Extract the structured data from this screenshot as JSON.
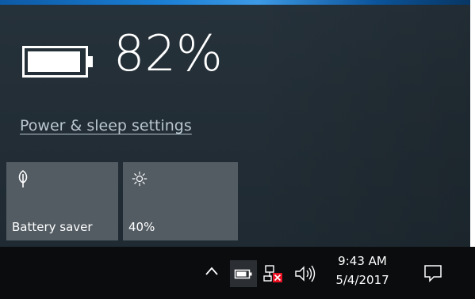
{
  "battery_flyout": {
    "percent": "82%",
    "settings_link": "Power & sleep settings",
    "battery_level": 0.82
  },
  "quick_actions": [
    {
      "label": "Battery saver",
      "icon": "leaf-icon"
    },
    {
      "label": "40%",
      "icon": "brightness-icon"
    }
  ],
  "taskbar": {
    "time": "9:43 AM",
    "date": "5/4/2017",
    "tray_icons": [
      "chevron-up-icon",
      "battery-icon",
      "network-disconnected-icon",
      "volume-icon",
      "action-center-icon"
    ]
  },
  "colors": {
    "flyout_bg": "#232e36",
    "tile_bg": "#535c63",
    "taskbar_bg": "#0a0c0e",
    "accent": "#1b7fd4",
    "error_red": "#e81123"
  }
}
